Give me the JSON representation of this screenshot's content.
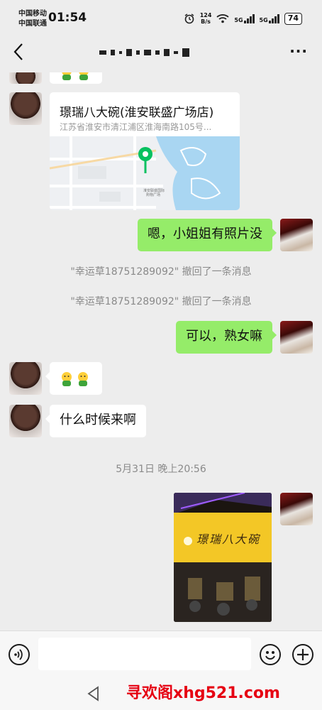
{
  "status_bar": {
    "carrier_1": "中国移动",
    "carrier_2": "中国联通",
    "time": "01:54",
    "net_speed_value": "124",
    "net_speed_unit": "B/s",
    "signal_1": "5G",
    "signal_2": "5G",
    "battery": "74"
  },
  "header": {
    "contact_name_redacted": "",
    "icons": {
      "back": "chevron-left-icon",
      "more": "more-icon"
    }
  },
  "messages": {
    "location": {
      "name": "璟瑞八大碗(淮安联盛广场店)",
      "address": "江苏省淮安市清江浦区淮海南路105号...",
      "map_labels": [
        "淮安联盛国际",
        "购物广场"
      ]
    },
    "sent_1": "嗯，小姐姐有照片没",
    "recall_1": "\"幸运草18751289092\" 撤回了一条消息",
    "recall_2": "\"幸运草18751289092\" 撤回了一条消息",
    "sent_2": "可以，熟女嘛",
    "recv_emoji": "emoji-pair",
    "recv_text": "什么时候来啊",
    "timestamp": "5月31日 晚上20:56",
    "photo": {
      "sign_text": "璟瑞八大碗",
      "alt": "restaurant-photo"
    }
  },
  "input_bar": {
    "icons": {
      "voice": "voice-icon",
      "emoji": "emoji-icon",
      "plus": "plus-icon"
    }
  },
  "watermark": "寻欢阁xhg521.com",
  "colors": {
    "bubble_green": "#95ec69",
    "bg": "#ededed",
    "watermark": "#e60012"
  }
}
